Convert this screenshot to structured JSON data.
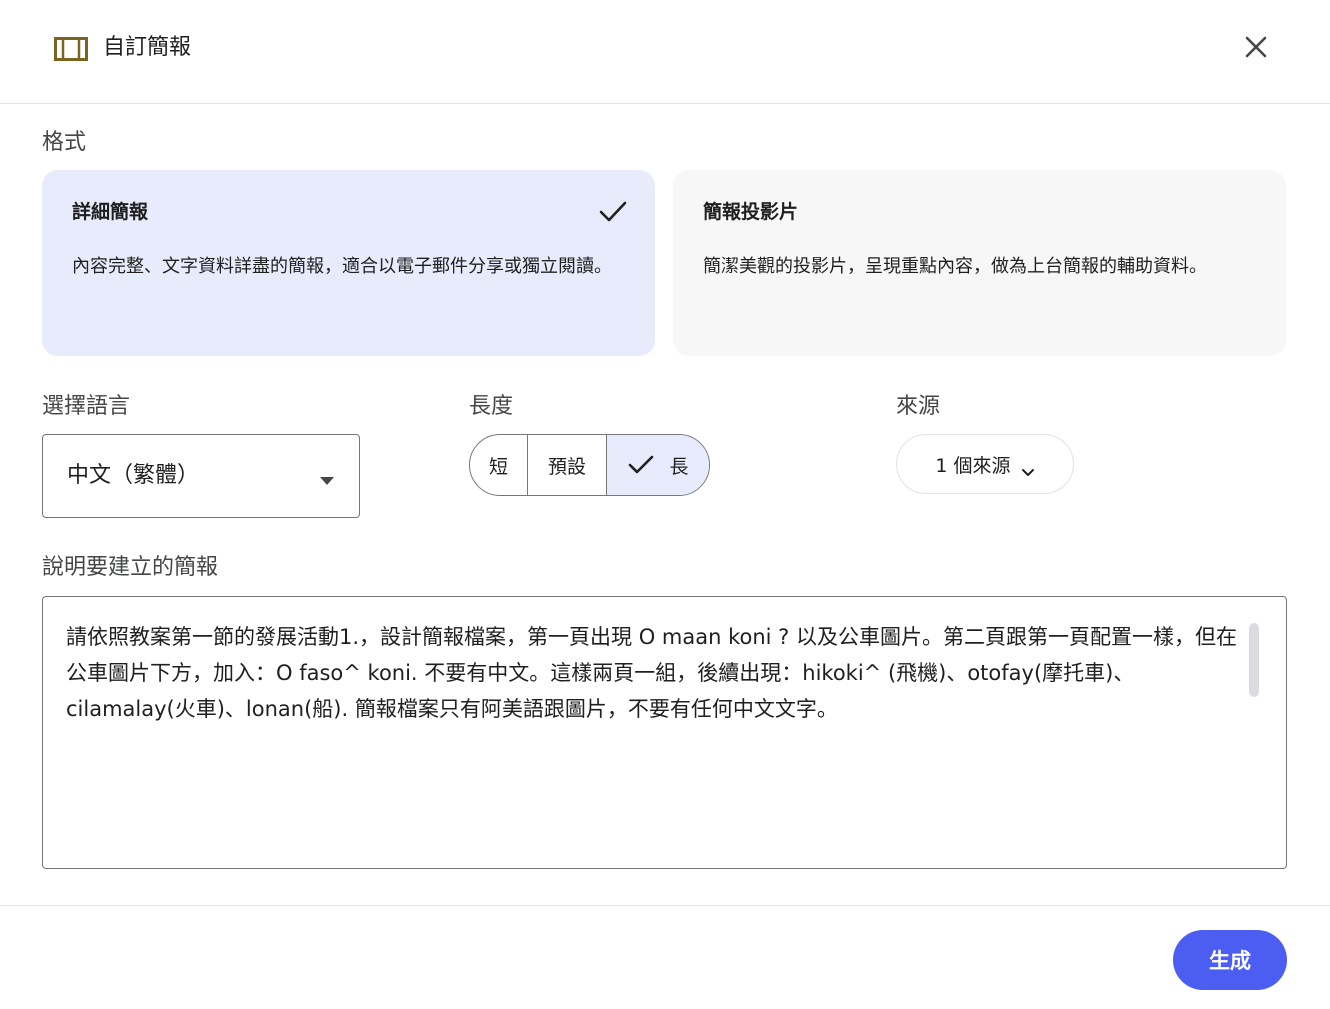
{
  "header": {
    "title": "自訂簡報",
    "icon": "slides-icon",
    "close_icon": "close-icon"
  },
  "format": {
    "label": "格式",
    "options": [
      {
        "title": "詳細簡報",
        "description": "內容完整、文字資料詳盡的簡報，適合以電子郵件分享或獨立閱讀。",
        "selected": true
      },
      {
        "title": "簡報投影片",
        "description": "簡潔美觀的投影片，呈現重點內容，做為上台簡報的輔助資料。",
        "selected": false
      }
    ]
  },
  "language": {
    "label": "選擇語言",
    "value": "中文（繁體）"
  },
  "length": {
    "label": "長度",
    "options": [
      "短",
      "預設",
      "長"
    ],
    "selected": "長"
  },
  "source": {
    "label": "來源",
    "button_label": "1 個來源"
  },
  "prompt": {
    "label": "說明要建立的簡報",
    "value": "請依照教案第一節的發展活動1.，設計簡報檔案，第一頁出現 O maan koni ? 以及公車圖片。第二頁跟第一頁配置一樣，但在公車圖片下方，加入：O faso^ koni. 不要有中文。這樣兩頁一組，後續出現：hikoki^ (飛機)、otofay(摩托車)、cilamalay(火車)、lonan(船). 簡報檔案只有阿美語跟圖片，不要有任何中文文字。"
  },
  "footer": {
    "generate_label": "生成"
  },
  "colors": {
    "accent": "#4c5ef2",
    "selected_bg": "#e8ebfb",
    "icon_brown": "#7a6420"
  }
}
